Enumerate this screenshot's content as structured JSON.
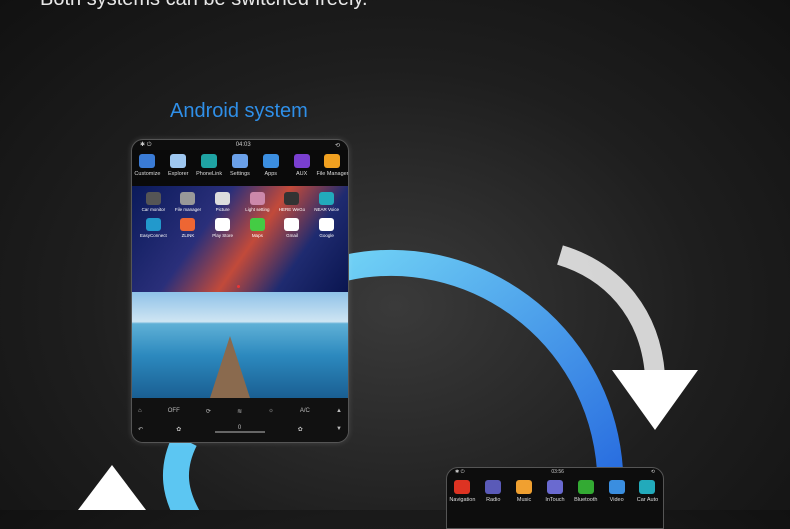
{
  "headline": "Both systems can be switched freely.",
  "android_title": "Android system",
  "tablet": {
    "status_time": "04:03",
    "top_apps": [
      {
        "label": "Customize",
        "icon": "customize-icon",
        "color": "#3a7bd5"
      },
      {
        "label": "Explorer",
        "icon": "explorer-icon",
        "color": "#9ec7f0"
      },
      {
        "label": "PhoneLink",
        "icon": "phonelink-icon",
        "color": "#1fa3a3"
      },
      {
        "label": "Settings",
        "icon": "settings-icon",
        "color": "#6aa0e8"
      },
      {
        "label": "Apps",
        "icon": "apps-icon",
        "color": "#3b8ee0"
      },
      {
        "label": "AUX",
        "icon": "aux-icon",
        "color": "#7a3fd0"
      },
      {
        "label": "File Manager",
        "icon": "file-manager-icon",
        "color": "#f0a020"
      }
    ],
    "desktop_apps": [
      {
        "label": "Car monitor",
        "icon": "car-monitor-icon",
        "color": "#555"
      },
      {
        "label": "File manager",
        "icon": "file-manager-icon",
        "color": "#999"
      },
      {
        "label": "Picture",
        "icon": "picture-icon",
        "color": "#ddd"
      },
      {
        "label": "Light setting",
        "icon": "light-setting-icon",
        "color": "#c8a"
      },
      {
        "label": "HERE WeGo",
        "icon": "here-wego-icon",
        "color": "#333"
      },
      {
        "label": "NEAR Voice",
        "icon": "near-voice-icon",
        "color": "#2ab"
      },
      {
        "label": "EasyConnect",
        "icon": "easyconnect-icon",
        "color": "#29c"
      },
      {
        "label": "ZLINK",
        "icon": "zlink-icon",
        "color": "#e63"
      },
      {
        "label": "Play Store",
        "icon": "play-store-icon",
        "color": "#fff"
      },
      {
        "label": "Maps",
        "icon": "maps-icon",
        "color": "#4c4"
      },
      {
        "label": "Gmail",
        "icon": "gmail-icon",
        "color": "#fff"
      },
      {
        "label": "Google",
        "icon": "google-icon",
        "color": "#fff"
      }
    ],
    "controls": {
      "off": "OFF",
      "ac": "A/C",
      "fan_value": "0"
    }
  },
  "tablet2": {
    "status_time": "03:56",
    "apps": [
      {
        "label": "Navigation",
        "icon": "navigation-icon",
        "color": "#d32"
      },
      {
        "label": "Radio",
        "icon": "radio-icon",
        "color": "#5a5ab8"
      },
      {
        "label": "Music",
        "icon": "music-icon",
        "color": "#f0a030"
      },
      {
        "label": "InTouch",
        "icon": "intouch-icon",
        "color": "#6a6ad0"
      },
      {
        "label": "Bluetooth",
        "icon": "bluetooth-icon",
        "color": "#3a3"
      },
      {
        "label": "Video",
        "icon": "video-icon",
        "color": "#3a8ee0"
      },
      {
        "label": "Car Auto",
        "icon": "car-auto-icon",
        "color": "#2ab"
      }
    ]
  }
}
